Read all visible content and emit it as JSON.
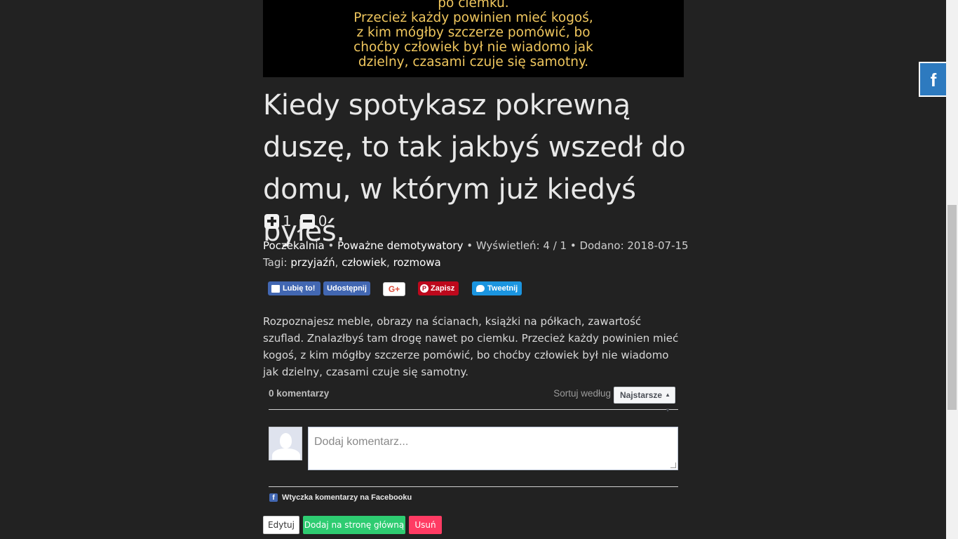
{
  "image_text": [
    "po ciemku.",
    "Przecież każdy powinien mieć kogoś,",
    "z kim mógłby szczerze pomówić, bo",
    "choćby człowiek był nie wiadomo jak",
    "dzielny, czasami czuje się samotny."
  ],
  "post": {
    "title": "Kiedy spotykasz pokrewną duszę, to tak jakbyś wszedł do domu, w którym już kiedyś byłeś.",
    "upvotes": "1",
    "downvotes": "0",
    "category": "Poczekalnia",
    "sep1": " • ",
    "subcategory": "Poważne demotywatory",
    "views": " • Wyświetleń: 4 / 1 • Dodano: 2018-07-15",
    "tags_label": "Tagi: ",
    "tags": [
      "przyjaźń",
      "człowiek",
      "rozmowa"
    ],
    "description": "Rozpoznajesz meble, obrazy na ścianach, książki na półkach, zawartość szuflad. Znalazłbyś tam drogę nawet po ciemku. Przecież każdy powinien mieć kogoś, z kim mógłby szczerze pomówić, bo choćby człowiek był nie wiadomo jak dzielny, czasami czuje się samotny."
  },
  "share": {
    "fb_like": "Lubię to!",
    "fb_share": "Udostępnij",
    "gplus": "G+",
    "pin": "Zapisz",
    "tweet": "Tweetnij"
  },
  "comments": {
    "count": "0 komentarzy",
    "sort_label": "Sortuj według",
    "sort_value": "Najstarsze",
    "placeholder": "Dodaj komentarz...",
    "plugin_label": "Wtyczka komentarzy na Facebooku"
  },
  "actions": {
    "edit": "Edytuj",
    "add_home": "Dodaj na stronę główną",
    "delete": "Usuń"
  },
  "side": {
    "fb": "f"
  },
  "colors": {
    "background": "#222222",
    "image_text": "#f0c75e",
    "green": "#2ecc71",
    "red": "#ff3b63",
    "facebook": "#4267b2",
    "twitter": "#1b95e0",
    "pinterest": "#bd081c"
  }
}
